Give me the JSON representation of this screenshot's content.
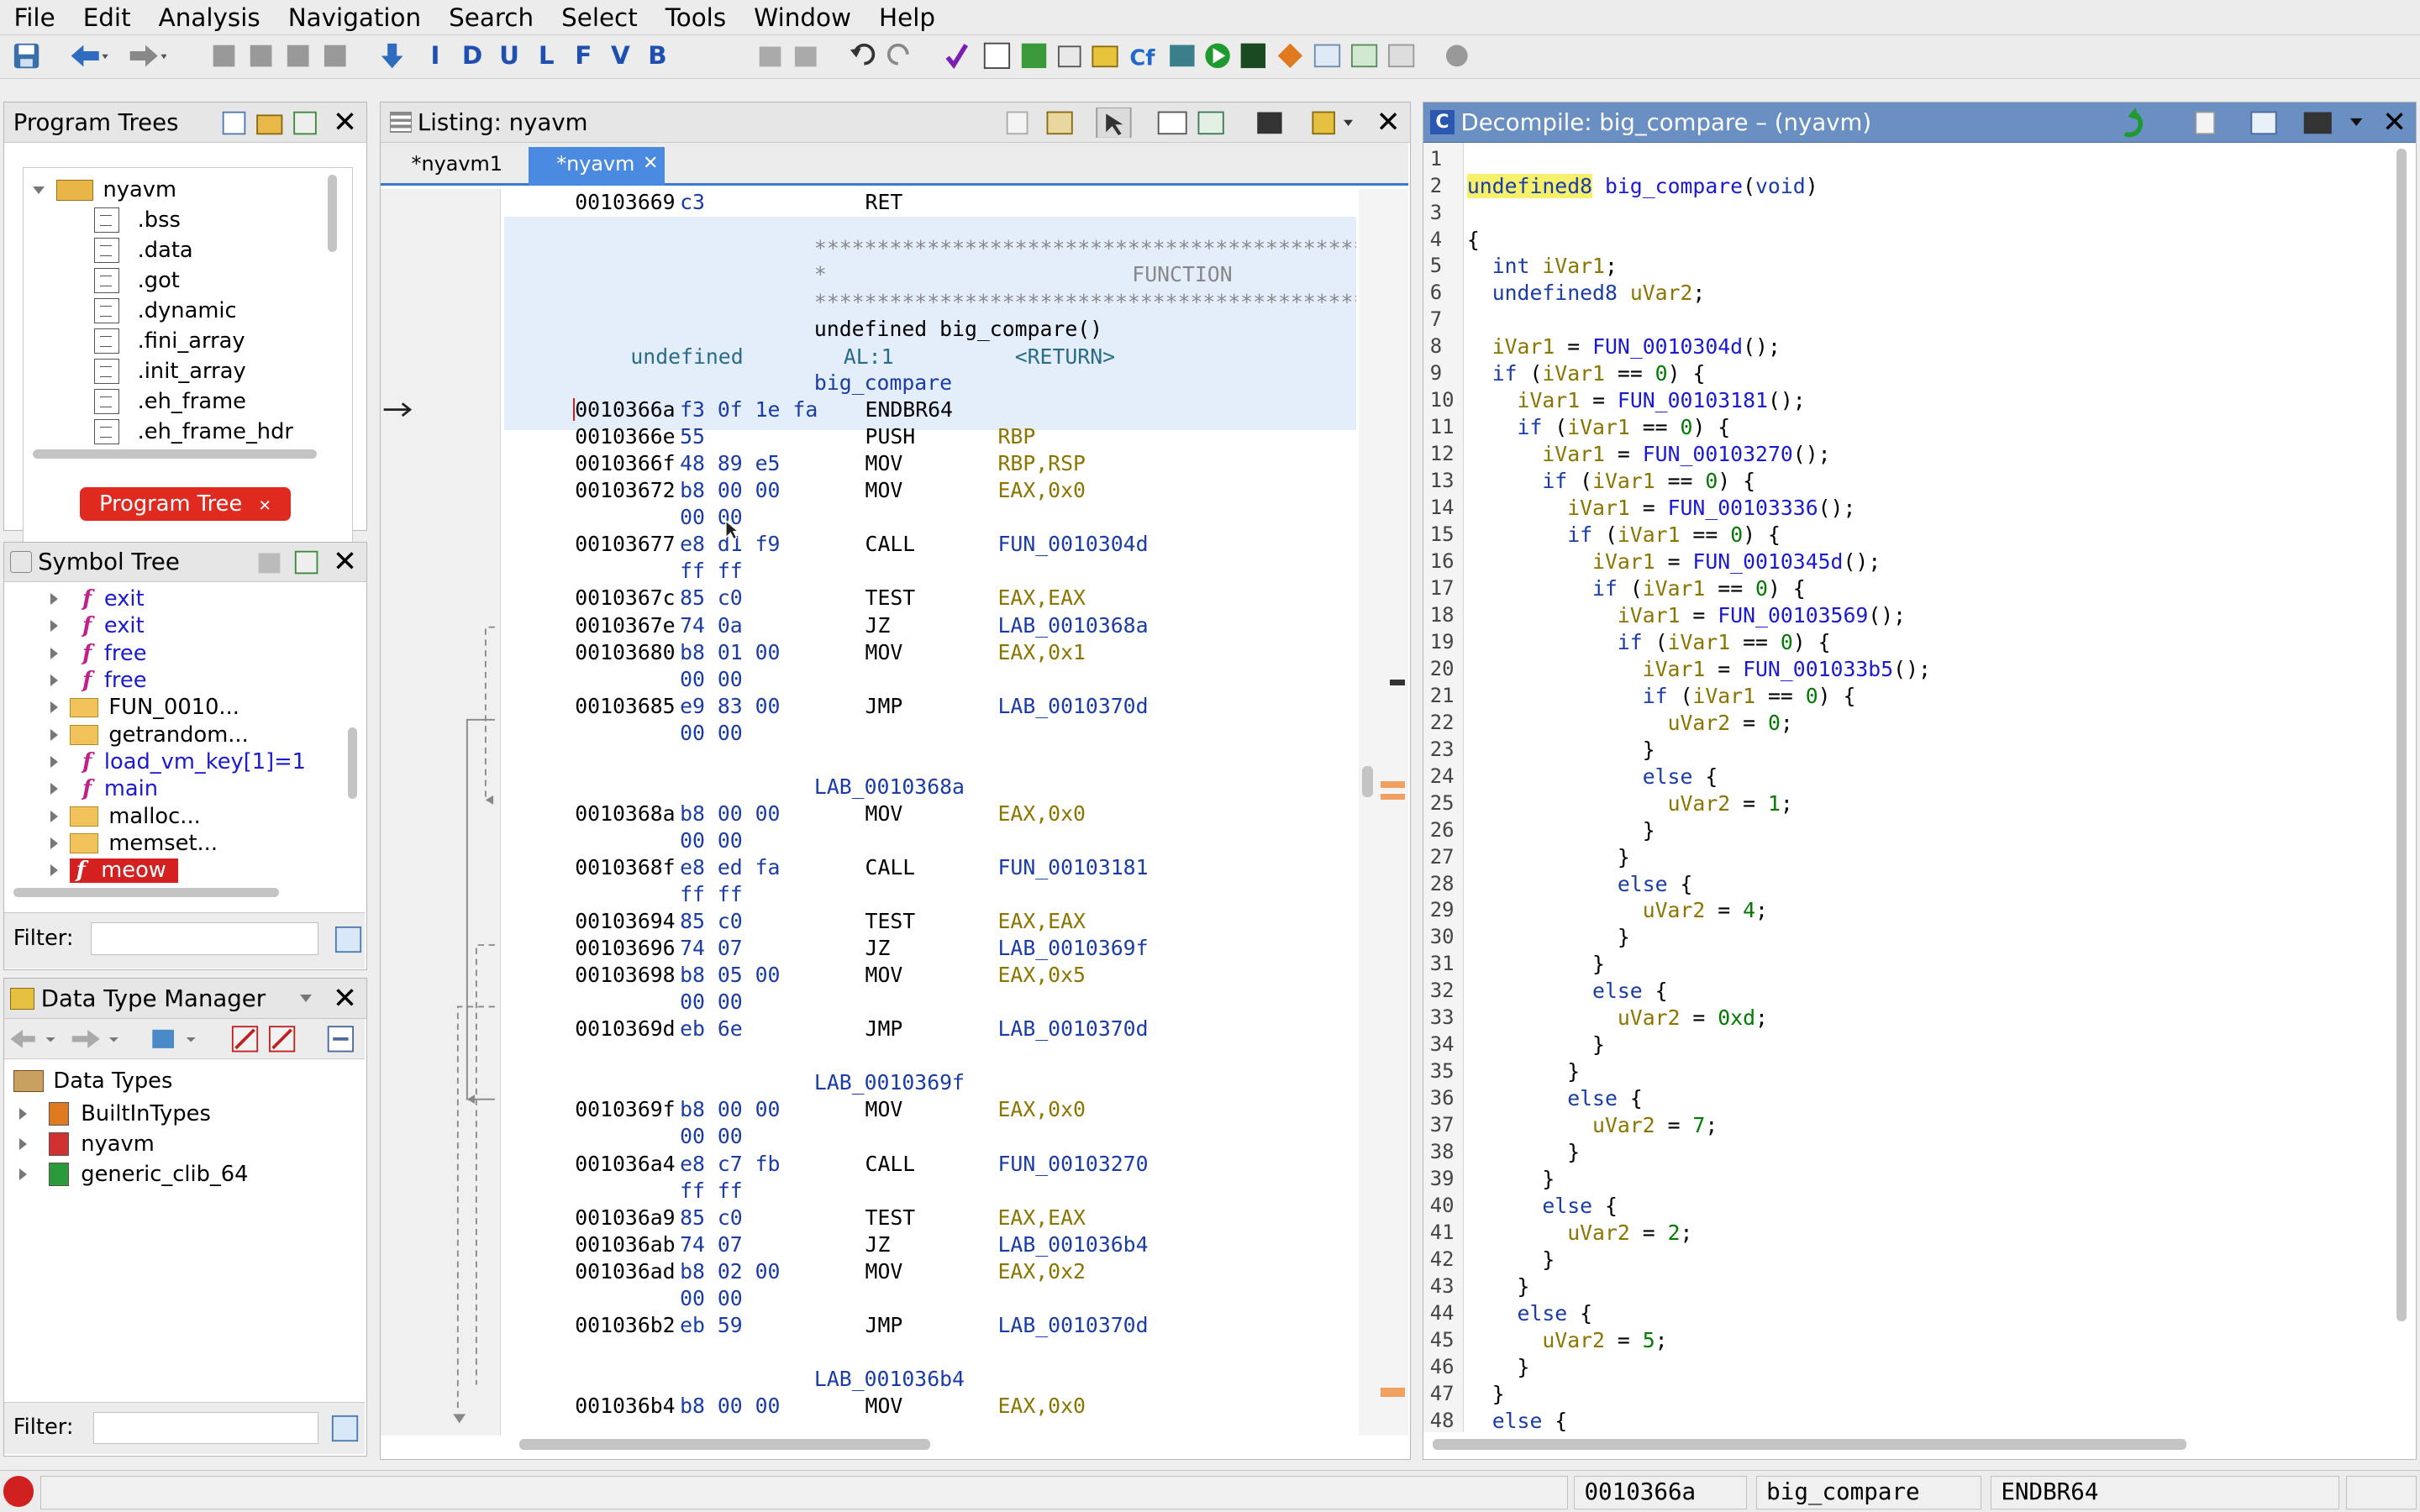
{
  "menu": [
    "File",
    "Edit",
    "Analysis",
    "Navigation",
    "Search",
    "Select",
    "Tools",
    "Window",
    "Help"
  ],
  "toolbar": {
    "letters": [
      "I",
      "D",
      "U",
      "L",
      "F",
      "V",
      "B"
    ]
  },
  "program_trees": {
    "title": "Program Trees",
    "root": "nyavm",
    "items": [
      ".bss",
      ".data",
      ".got",
      ".dynamic",
      ".fini_array",
      ".init_array",
      ".eh_frame",
      ".eh_frame_hdr"
    ],
    "tab": "Program Tree"
  },
  "symbol_tree": {
    "title": "Symbol Tree",
    "items": [
      {
        "label": "exit",
        "kind": "func"
      },
      {
        "label": "exit",
        "kind": "func"
      },
      {
        "label": "free",
        "kind": "func"
      },
      {
        "label": "free",
        "kind": "func"
      },
      {
        "label": "FUN_0010...",
        "kind": "folder"
      },
      {
        "label": "getrandom...",
        "kind": "folder"
      },
      {
        "label": "load_vm_key[1]=1",
        "kind": "func"
      },
      {
        "label": "main",
        "kind": "func"
      },
      {
        "label": "malloc...",
        "kind": "folder"
      },
      {
        "label": "memset...",
        "kind": "folder"
      },
      {
        "label": "meow",
        "kind": "selected"
      }
    ],
    "filter_label": "Filter:"
  },
  "data_type_manager": {
    "title": "Data Type Manager",
    "root": "Data Types",
    "items": [
      "BuiltInTypes",
      "nyavm",
      "generic_clib_64"
    ],
    "filter_label": "Filter:"
  },
  "listing": {
    "title": "Listing:  nyavm",
    "tabs": [
      "*nyavm1",
      "*nyavm"
    ],
    "header": {
      "stars": "************************************************************",
      "star": "*",
      "function_word": "FUNCTION",
      "signature": "undefined big_compare()",
      "ret_type": "undefined",
      "ret_reg": "AL:1",
      "ret_label": "<RETURN>",
      "func_label": "big_compare"
    },
    "first": {
      "addr": "00103669",
      "bytes": "c3",
      "mnem": "RET",
      "ops": ""
    },
    "rows": [
      {
        "addr": "0010366a",
        "bytes": "f3 0f 1e fa",
        "mnem": "ENDBR64",
        "ops": ""
      },
      {
        "addr": "0010366e",
        "bytes": "55",
        "mnem": "PUSH",
        "ops": "RBP"
      },
      {
        "addr": "0010366f",
        "bytes": "48 89 e5",
        "mnem": "MOV",
        "ops": "RBP,RSP"
      },
      {
        "addr": "00103672",
        "bytes": "b8 00 00",
        "mnem": "MOV",
        "ops": "EAX,0x0"
      },
      {
        "addr": "",
        "bytes": "00 00",
        "mnem": "",
        "ops": ""
      },
      {
        "addr": "00103677",
        "bytes": "e8 d1 f9",
        "mnem": "CALL",
        "ops": "FUN_0010304d"
      },
      {
        "addr": "",
        "bytes": "ff ff",
        "mnem": "",
        "ops": ""
      },
      {
        "addr": "0010367c",
        "bytes": "85 c0",
        "mnem": "TEST",
        "ops": "EAX,EAX"
      },
      {
        "addr": "0010367e",
        "bytes": "74 0a",
        "mnem": "JZ",
        "ops": "LAB_0010368a"
      },
      {
        "addr": "00103680",
        "bytes": "b8 01 00",
        "mnem": "MOV",
        "ops": "EAX,0x1"
      },
      {
        "addr": "",
        "bytes": "00 00",
        "mnem": "",
        "ops": ""
      },
      {
        "addr": "00103685",
        "bytes": "e9 83 00",
        "mnem": "JMP",
        "ops": "LAB_0010370d"
      },
      {
        "addr": "",
        "bytes": "00 00",
        "mnem": "",
        "ops": ""
      },
      {
        "addr": "",
        "bytes": "",
        "mnem": "",
        "ops": ""
      },
      {
        "label": "LAB_0010368a"
      },
      {
        "addr": "0010368a",
        "bytes": "b8 00 00",
        "mnem": "MOV",
        "ops": "EAX,0x0"
      },
      {
        "addr": "",
        "bytes": "00 00",
        "mnem": "",
        "ops": ""
      },
      {
        "addr": "0010368f",
        "bytes": "e8 ed fa",
        "mnem": "CALL",
        "ops": "FUN_00103181"
      },
      {
        "addr": "",
        "bytes": "ff ff",
        "mnem": "",
        "ops": ""
      },
      {
        "addr": "00103694",
        "bytes": "85 c0",
        "mnem": "TEST",
        "ops": "EAX,EAX"
      },
      {
        "addr": "00103696",
        "bytes": "74 07",
        "mnem": "JZ",
        "ops": "LAB_0010369f"
      },
      {
        "addr": "00103698",
        "bytes": "b8 05 00",
        "mnem": "MOV",
        "ops": "EAX,0x5"
      },
      {
        "addr": "",
        "bytes": "00 00",
        "mnem": "",
        "ops": ""
      },
      {
        "addr": "0010369d",
        "bytes": "eb 6e",
        "mnem": "JMP",
        "ops": "LAB_0010370d"
      },
      {
        "addr": "",
        "bytes": "",
        "mnem": "",
        "ops": ""
      },
      {
        "label": "LAB_0010369f"
      },
      {
        "addr": "0010369f",
        "bytes": "b8 00 00",
        "mnem": "MOV",
        "ops": "EAX,0x0"
      },
      {
        "addr": "",
        "bytes": "00 00",
        "mnem": "",
        "ops": ""
      },
      {
        "addr": "001036a4",
        "bytes": "e8 c7 fb",
        "mnem": "CALL",
        "ops": "FUN_00103270"
      },
      {
        "addr": "",
        "bytes": "ff ff",
        "mnem": "",
        "ops": ""
      },
      {
        "addr": "001036a9",
        "bytes": "85 c0",
        "mnem": "TEST",
        "ops": "EAX,EAX"
      },
      {
        "addr": "001036ab",
        "bytes": "74 07",
        "mnem": "JZ",
        "ops": "LAB_001036b4"
      },
      {
        "addr": "001036ad",
        "bytes": "b8 02 00",
        "mnem": "MOV",
        "ops": "EAX,0x2"
      },
      {
        "addr": "",
        "bytes": "00 00",
        "mnem": "",
        "ops": ""
      },
      {
        "addr": "001036b2",
        "bytes": "eb 59",
        "mnem": "JMP",
        "ops": "LAB_0010370d"
      },
      {
        "addr": "",
        "bytes": "",
        "mnem": "",
        "ops": ""
      },
      {
        "label": "LAB_001036b4"
      },
      {
        "addr": "001036b4",
        "bytes": "b8 00 00",
        "mnem": "MOV",
        "ops": "EAX,0x0"
      }
    ]
  },
  "decompile": {
    "title": "Decompile: big_compare –  (nyavm)",
    "lines": [
      "",
      "undefined8 big_compare(void)",
      "",
      "{",
      "  int iVar1;",
      "  undefined8 uVar2;",
      "",
      "  iVar1 = FUN_0010304d();",
      "  if (iVar1 == 0) {",
      "    iVar1 = FUN_00103181();",
      "    if (iVar1 == 0) {",
      "      iVar1 = FUN_00103270();",
      "      if (iVar1 == 0) {",
      "        iVar1 = FUN_00103336();",
      "        if (iVar1 == 0) {",
      "          iVar1 = FUN_0010345d();",
      "          if (iVar1 == 0) {",
      "            iVar1 = FUN_00103569();",
      "            if (iVar1 == 0) {",
      "              iVar1 = FUN_001033b5();",
      "              if (iVar1 == 0) {",
      "                uVar2 = 0;",
      "              }",
      "              else {",
      "                uVar2 = 1;",
      "              }",
      "            }",
      "            else {",
      "              uVar2 = 4;",
      "            }",
      "          }",
      "          else {",
      "            uVar2 = 0xd;",
      "          }",
      "        }",
      "        else {",
      "          uVar2 = 7;",
      "        }",
      "      }",
      "      else {",
      "        uVar2 = 2;",
      "      }",
      "    }",
      "    else {",
      "      uVar2 = 5;",
      "    }",
      "  }",
      "  else {"
    ]
  },
  "status": {
    "address": "0010366a",
    "function": "big_compare",
    "instruction": "ENDBR64"
  }
}
